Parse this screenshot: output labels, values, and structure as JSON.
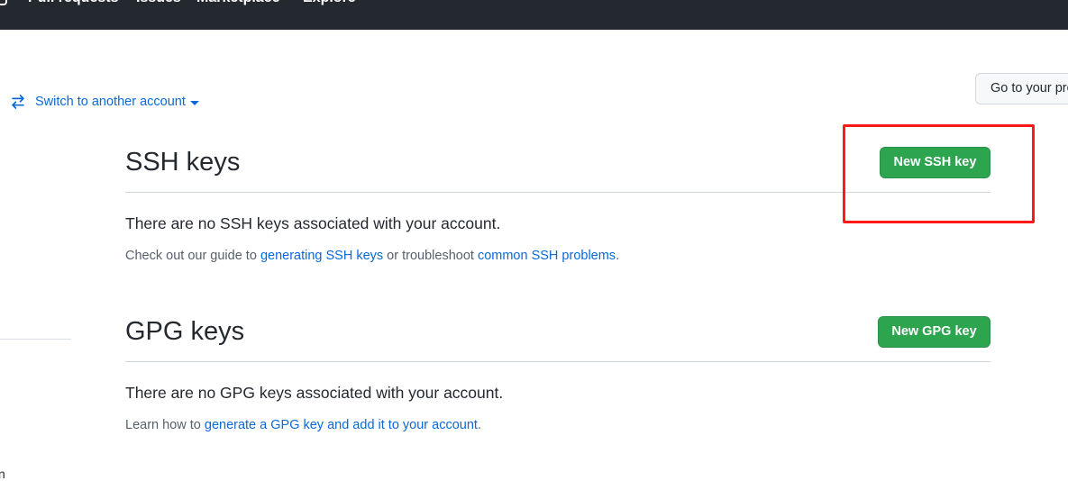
{
  "topbar": {
    "nav": [
      "Pull requests",
      "Issues",
      "Marketplace",
      "Explore"
    ]
  },
  "account": {
    "switch_label": "Switch to another account",
    "goto_profile_label": "Go to your profile"
  },
  "sidebar": {
    "fragment_text": "n"
  },
  "ssh": {
    "title": "SSH keys",
    "new_button": "New SSH key",
    "empty_message": "There are no SSH keys associated with your account.",
    "help_prefix": "Check out our guide to ",
    "help_link1": "generating SSH keys",
    "help_middle": " or troubleshoot ",
    "help_link2": "common SSH problems",
    "help_suffix": "."
  },
  "gpg": {
    "title": "GPG keys",
    "new_button": "New GPG key",
    "empty_message": "There are no GPG keys associated with your account.",
    "help_prefix": "Learn how to ",
    "help_link": "generate a GPG key and add it to your account",
    "help_suffix": "."
  },
  "colors": {
    "topbar_bg": "#24292f",
    "link": "#0969da",
    "primary_button": "#2da44e",
    "highlight_annotation": "#ff1a1a"
  }
}
